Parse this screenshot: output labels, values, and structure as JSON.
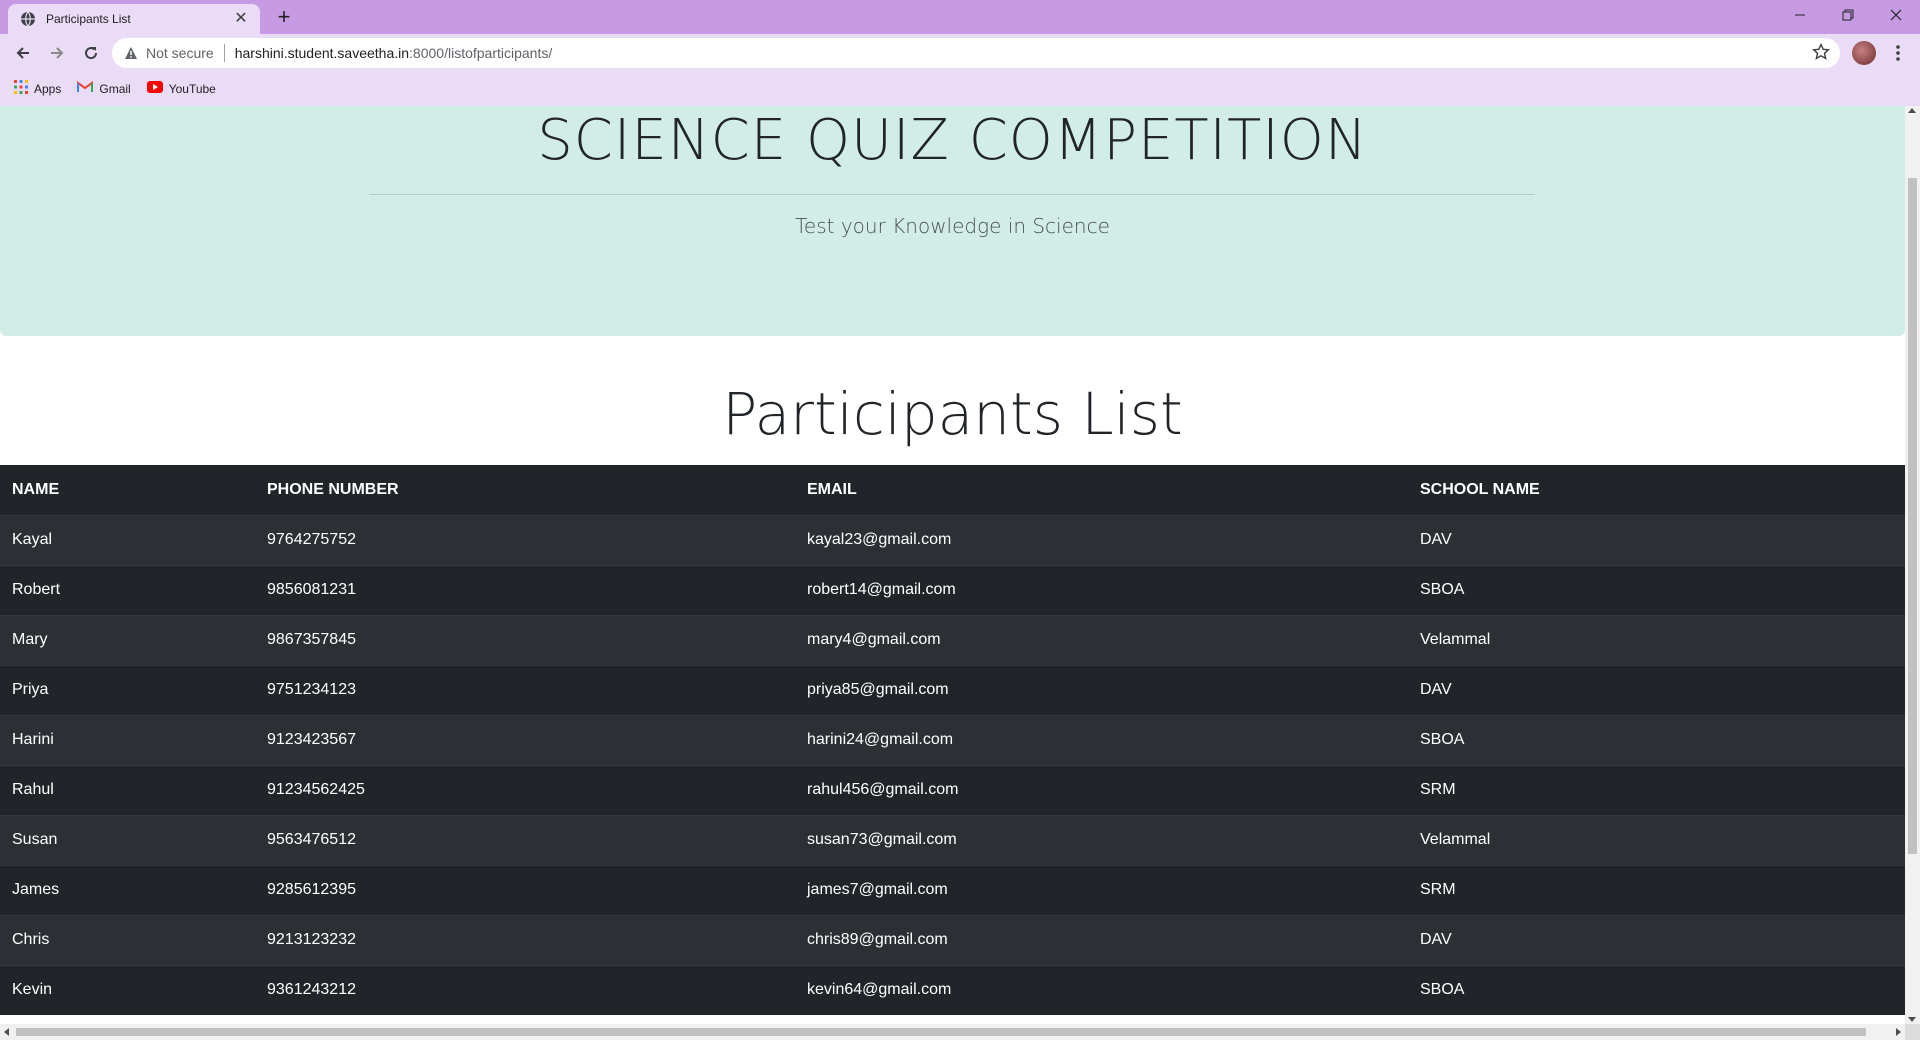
{
  "browser": {
    "tab_title": "Participants List",
    "address": {
      "security_label": "Not secure",
      "url_host": "harshini.student.saveetha.in",
      "url_rest": ":8000/listofparticipants/"
    },
    "bookmarks": [
      {
        "label": "Apps",
        "icon": "apps-grid-icon"
      },
      {
        "label": "Gmail",
        "icon": "gmail-icon"
      },
      {
        "label": "YouTube",
        "icon": "youtube-icon"
      }
    ],
    "colors": {
      "tabbar": "#c69be3",
      "toolbar": "#eadcf6"
    }
  },
  "page": {
    "hero_title": "SCIENCE QUIZ COMPETITION",
    "hero_subtitle": "Test your Knowledge in Science",
    "list_title": "Participants List",
    "colors": {
      "hero_bg": "#d2ede6",
      "table_bg": "#212529"
    },
    "table": {
      "headers": [
        "NAME",
        "PHONE NUMBER",
        "EMAIL",
        "SCHOOL NAME"
      ],
      "rows": [
        [
          "Kayal",
          "9764275752",
          "kayal23@gmail.com",
          "DAV"
        ],
        [
          "Robert",
          "9856081231",
          "robert14@gmail.com",
          "SBOA"
        ],
        [
          "Mary",
          "9867357845",
          "mary4@gmail.com",
          "Velammal"
        ],
        [
          "Priya",
          "9751234123",
          "priya85@gmail.com",
          "DAV"
        ],
        [
          "Harini",
          "9123423567",
          "harini24@gmail.com",
          "SBOA"
        ],
        [
          "Rahul",
          "91234562425",
          "rahul456@gmail.com",
          "SRM"
        ],
        [
          "Susan",
          "9563476512",
          "susan73@gmail.com",
          "Velammal"
        ],
        [
          "James",
          "9285612395",
          "james7@gmail.com",
          "SRM"
        ],
        [
          "Chris",
          "9213123232",
          "chris89@gmail.com",
          "DAV"
        ],
        [
          "Kevin",
          "9361243212",
          "kevin64@gmail.com",
          "SBOA"
        ]
      ]
    }
  }
}
